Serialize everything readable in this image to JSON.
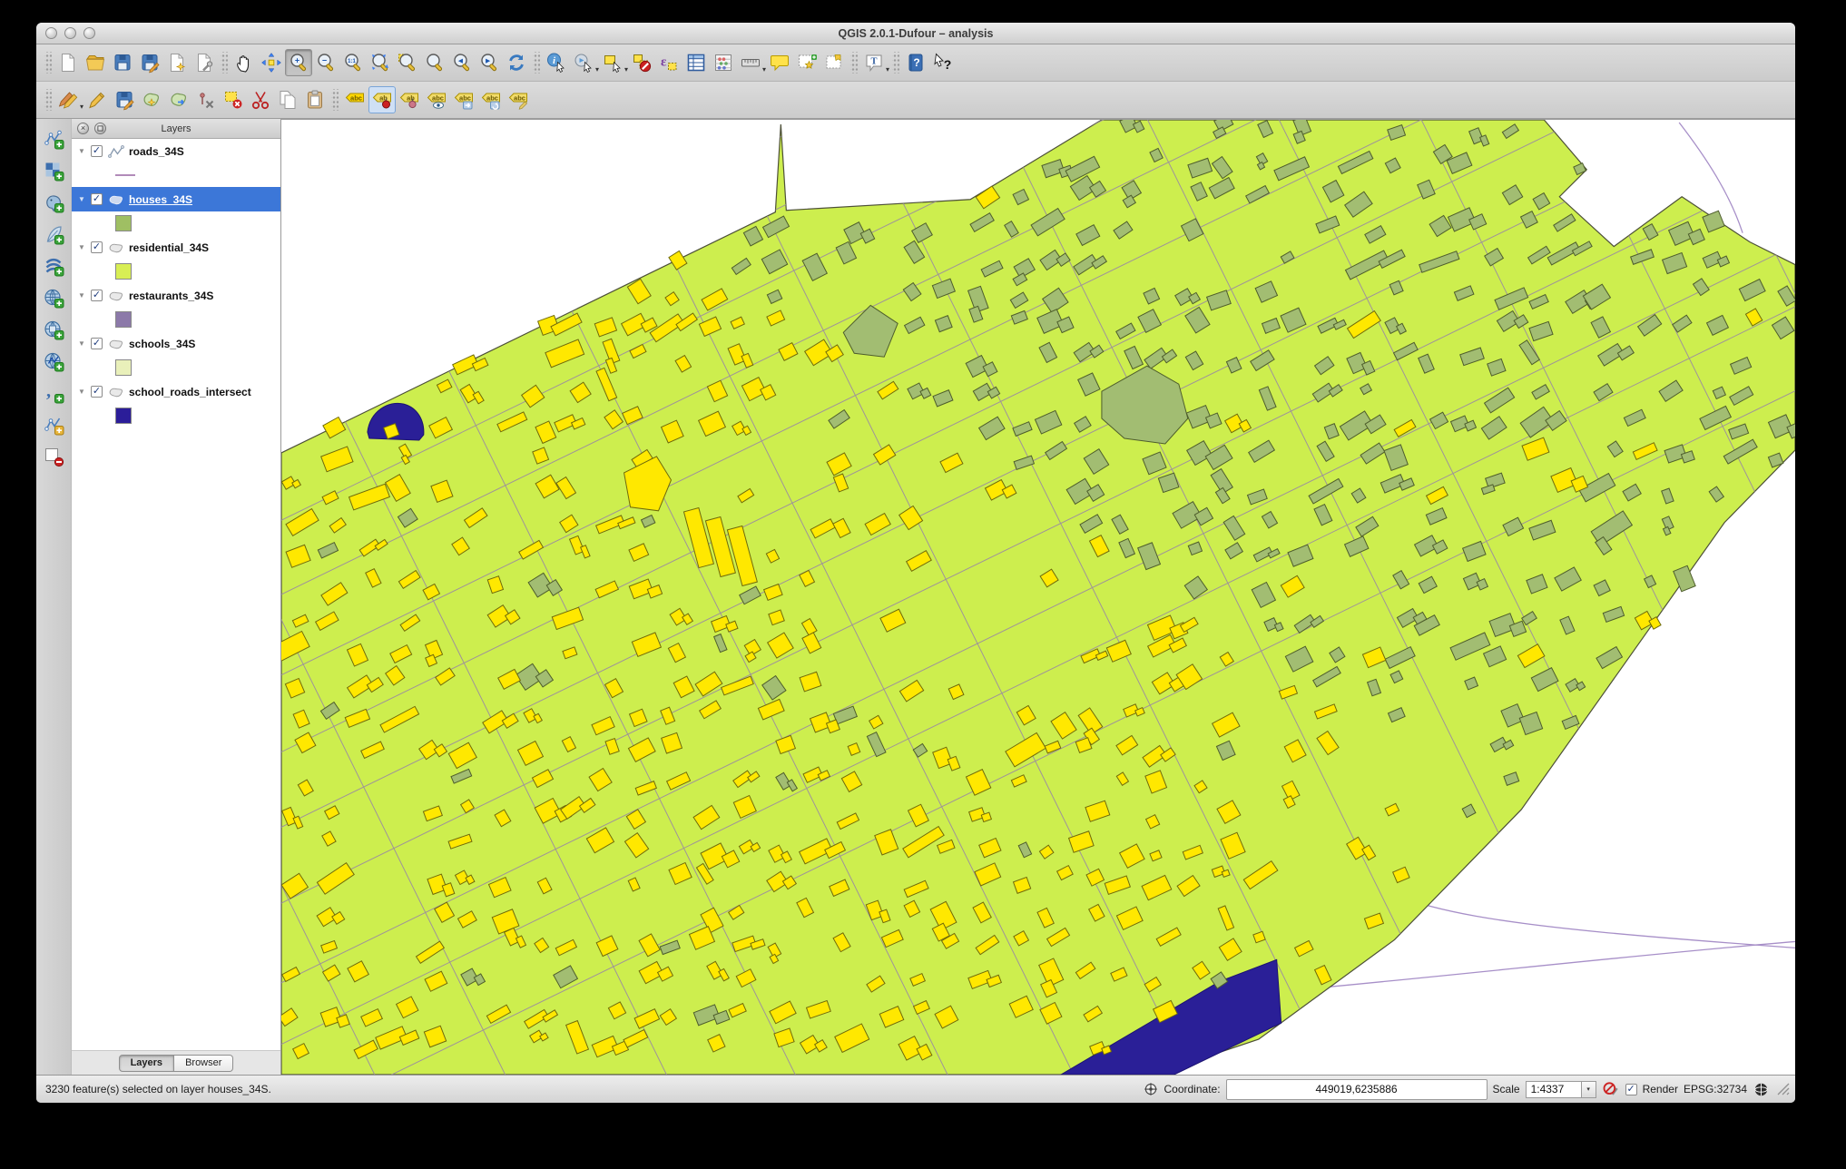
{
  "window": {
    "title": "QGIS 2.0.1-Dufour – analysis"
  },
  "toolbar_main": [
    {
      "name": "new-project",
      "type": "page"
    },
    {
      "name": "open-project",
      "type": "folder"
    },
    {
      "name": "save-project",
      "type": "floppy"
    },
    {
      "name": "save-project-as",
      "type": "floppy-edit"
    },
    {
      "name": "new-print-composer",
      "type": "page-star"
    },
    {
      "name": "composer-manager",
      "type": "page-wrench"
    },
    {
      "name": "sep1",
      "type": "sep"
    },
    {
      "name": "pan-map",
      "type": "hand"
    },
    {
      "name": "pan-to-selection",
      "type": "arrows"
    },
    {
      "name": "zoom-in",
      "type": "mag",
      "badge": "+",
      "active": true
    },
    {
      "name": "zoom-out",
      "type": "mag",
      "badge": "−"
    },
    {
      "name": "zoom-native",
      "type": "mag",
      "badge": "1:1"
    },
    {
      "name": "zoom-full",
      "type": "mag-expand"
    },
    {
      "name": "zoom-to-selection",
      "type": "mag-sel"
    },
    {
      "name": "zoom-to-layer",
      "type": "mag"
    },
    {
      "name": "zoom-last",
      "type": "mag",
      "badge": "◂"
    },
    {
      "name": "zoom-next",
      "type": "mag",
      "badge": "▸"
    },
    {
      "name": "refresh-map",
      "type": "refresh"
    },
    {
      "name": "sep2",
      "type": "sep"
    },
    {
      "name": "identify-features",
      "type": "identify"
    },
    {
      "name": "run-feature-action",
      "type": "action",
      "dropdown": true
    },
    {
      "name": "select-features",
      "type": "select",
      "dropdown": true
    },
    {
      "name": "deselect-features",
      "type": "deselect"
    },
    {
      "name": "select-by-expression",
      "type": "expression"
    },
    {
      "name": "open-attribute-table",
      "type": "table"
    },
    {
      "name": "field-calculator",
      "type": "abacus"
    },
    {
      "name": "measure",
      "type": "ruler",
      "dropdown": true
    },
    {
      "name": "map-tips",
      "type": "speech"
    },
    {
      "name": "new-bookmark",
      "type": "bookmark-add"
    },
    {
      "name": "show-bookmarks",
      "type": "bookmark"
    },
    {
      "name": "sep3",
      "type": "sep"
    },
    {
      "name": "text-annotation",
      "type": "annotation",
      "dropdown": true
    },
    {
      "name": "sep4",
      "type": "sep"
    },
    {
      "name": "help-contents",
      "type": "help"
    },
    {
      "name": "whats-this",
      "type": "whatsthis"
    }
  ],
  "toolbar_edit": [
    {
      "name": "current-edits",
      "type": "pencils",
      "dropdown": true
    },
    {
      "name": "toggle-editing",
      "type": "pencil"
    },
    {
      "name": "save-layer-edits",
      "type": "floppy-edit"
    },
    {
      "name": "add-feature",
      "type": "blob-add"
    },
    {
      "name": "move-feature",
      "type": "blob-move"
    },
    {
      "name": "node-tool",
      "type": "node"
    },
    {
      "name": "delete-selected",
      "type": "del-sel"
    },
    {
      "name": "cut-features",
      "type": "cut"
    },
    {
      "name": "copy-features",
      "type": "copy"
    },
    {
      "name": "paste-features",
      "type": "paste"
    },
    {
      "name": "sep1",
      "type": "sep"
    },
    {
      "name": "labeling",
      "type": "tag",
      "text": "abc",
      "bright": true
    },
    {
      "name": "pin-label-active",
      "type": "tag",
      "text": "ab",
      "overlay": "pin-red",
      "highlight": true
    },
    {
      "name": "pin-label",
      "type": "tag",
      "text": "ab",
      "overlay": "pin-pink"
    },
    {
      "name": "show-hide-labels",
      "type": "tag",
      "text": "abc",
      "overlay": "eye"
    },
    {
      "name": "move-label",
      "type": "tag",
      "text": "abc",
      "overlay": "arrow"
    },
    {
      "name": "rotate-label",
      "type": "tag",
      "text": "abc",
      "overlay": "rotate"
    },
    {
      "name": "change-label-properties",
      "type": "tag",
      "text": "abc",
      "overlay": "edit"
    }
  ],
  "toolbar_layers": [
    {
      "name": "add-vector-layer",
      "type": "vector",
      "plus": true
    },
    {
      "name": "add-raster-layer",
      "type": "raster",
      "plus": true
    },
    {
      "name": "add-postgis-layer",
      "type": "postgis",
      "plus": true
    },
    {
      "name": "add-spatialite-layer",
      "type": "spatialite",
      "plus": true
    },
    {
      "name": "add-mssql-layer",
      "type": "mssql",
      "plus": true
    },
    {
      "name": "add-wms-layer",
      "type": "globe-wms",
      "plus": true
    },
    {
      "name": "add-wcs-layer",
      "type": "globe-wcs",
      "plus": true
    },
    {
      "name": "add-wfs-layer",
      "type": "globe-wfs",
      "plus": true
    },
    {
      "name": "add-delimited-text-layer",
      "type": "comma",
      "plus": true
    },
    {
      "name": "new-shapefile-layer",
      "type": "vector-new"
    },
    {
      "name": "remove-layer",
      "type": "remove"
    }
  ],
  "layers_panel": {
    "title": "Layers",
    "tabs": [
      {
        "label": "Layers",
        "active": true
      },
      {
        "label": "Browser",
        "active": false
      }
    ],
    "layers": [
      {
        "name": "roads_34S",
        "geom": "line",
        "swatch": "#b18bb9",
        "checked": true,
        "selected": false
      },
      {
        "name": "houses_34S",
        "geom": "polygon",
        "swatch": "#9fbf63",
        "checked": true,
        "selected": true
      },
      {
        "name": "residential_34S",
        "geom": "polygon",
        "swatch": "#d8ee54",
        "checked": true,
        "selected": false
      },
      {
        "name": "restaurants_34S",
        "geom": "polygon",
        "swatch": "#8c79a9",
        "checked": true,
        "selected": false
      },
      {
        "name": "schools_34S",
        "geom": "polygon",
        "swatch": "#e9f0ba",
        "checked": true,
        "selected": false
      },
      {
        "name": "school_roads_intersect",
        "geom": "polygon",
        "swatch": "#2b1d99",
        "checked": true,
        "selected": false
      }
    ]
  },
  "statusbar": {
    "message": "3230 feature(s) selected on layer houses_34S.",
    "coordinate_label": "Coordinate:",
    "coordinate_value": "449019,6235886",
    "scale_label": "Scale",
    "scale_value": "1:4337",
    "render_label": "Render",
    "render_checked": true,
    "epsg_label": "EPSG:32734"
  },
  "map": {
    "seed": 1337,
    "colors": {
      "background": "#ffffff",
      "residential": "#cdee4e",
      "residential_outline": "#4d5038",
      "house_selected": "#ffe800",
      "house_selected_outline": "#6f6a0a",
      "house_unselected": "#a2bd72",
      "house_unselected_outline": "#4e5d2c",
      "road": "#9a8aa2",
      "road_outside": "#a78fc8",
      "intersect": "#2a1f97",
      "intersect_outline": "#1c1370"
    }
  }
}
